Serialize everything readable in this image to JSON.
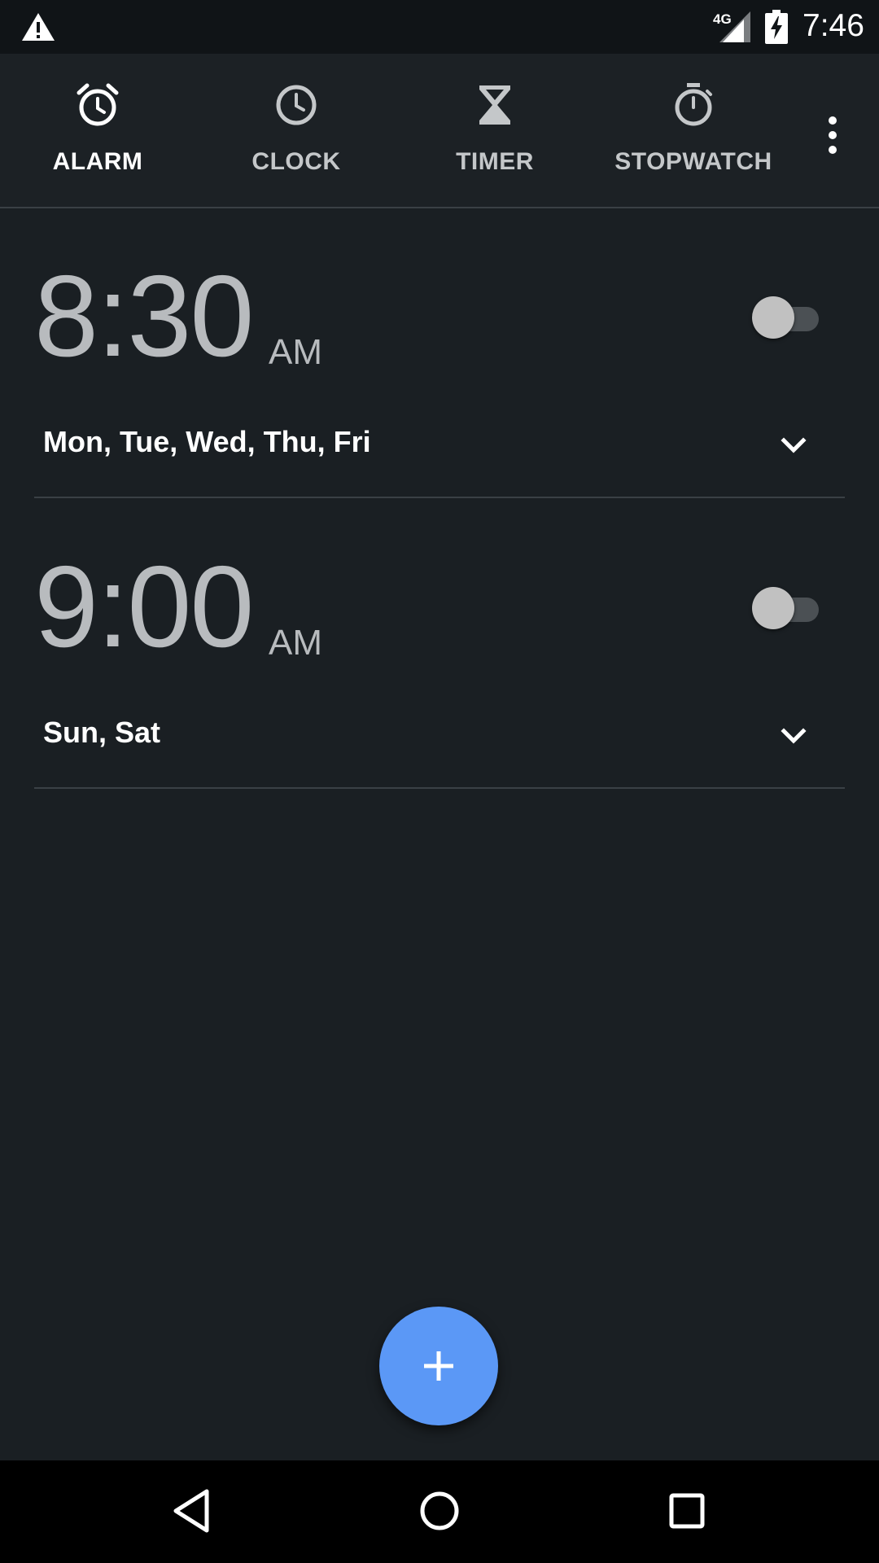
{
  "status_bar": {
    "network": "4G",
    "time": "7:46",
    "icons": [
      "warning-icon",
      "signal-icon",
      "battery-charging-icon"
    ]
  },
  "tabs": [
    {
      "label": "ALARM",
      "icon": "alarm-clock-icon",
      "active": true
    },
    {
      "label": "CLOCK",
      "icon": "clock-icon",
      "active": false
    },
    {
      "label": "TIMER",
      "icon": "hourglass-icon",
      "active": false
    },
    {
      "label": "STOPWATCH",
      "icon": "stopwatch-icon",
      "active": false
    }
  ],
  "alarms": [
    {
      "time": "8:30",
      "ampm": "AM",
      "days": "Mon, Tue, Wed, Thu, Fri",
      "enabled": false
    },
    {
      "time": "9:00",
      "ampm": "AM",
      "days": "Sun, Sat",
      "enabled": false
    }
  ],
  "fab": {
    "icon": "plus-icon"
  },
  "nav_bar": {
    "icons": [
      "back-icon",
      "home-icon",
      "recents-icon"
    ]
  },
  "colors": {
    "background": "#1a1f23",
    "tab_bar": "#1c2125",
    "status_bar": "#101417",
    "accent": "#5b98f6",
    "time_text": "#b8bbbe"
  }
}
